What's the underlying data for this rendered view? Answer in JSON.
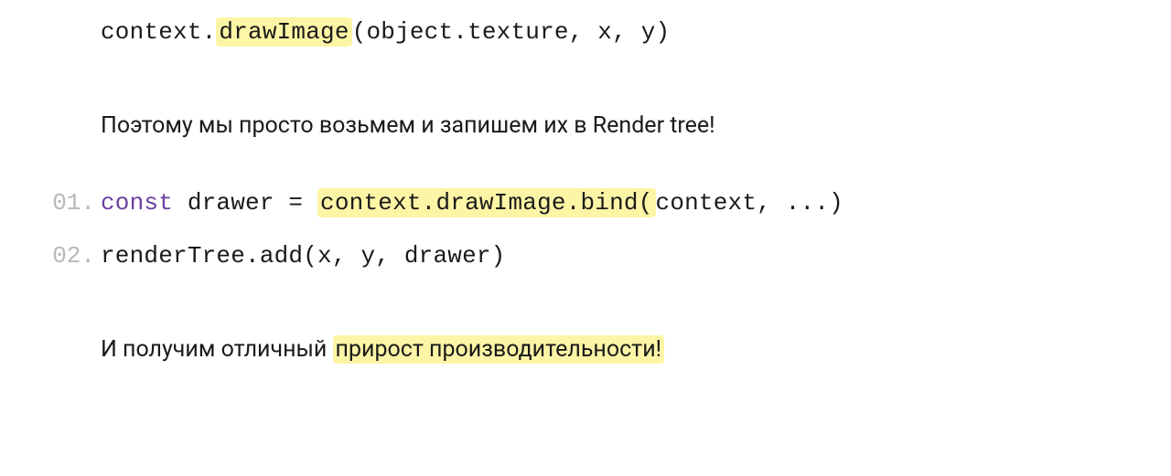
{
  "codeLine0": {
    "pre": "context.",
    "hl": "drawImage",
    "post": "(object.texture, x, y)"
  },
  "text1": "Поэтому мы просто возьмем и запишем их в Render tree!",
  "line1": {
    "num": "01.",
    "kw": "const",
    "mid": " drawer = ",
    "hl": "context.drawImage.bind(",
    "post": "context, ...)"
  },
  "line2": {
    "num": "02.",
    "code": "renderTree.add(x, y, drawer)"
  },
  "text2": {
    "pre": "И получим отличный ",
    "hl": "прирост производительности!"
  }
}
